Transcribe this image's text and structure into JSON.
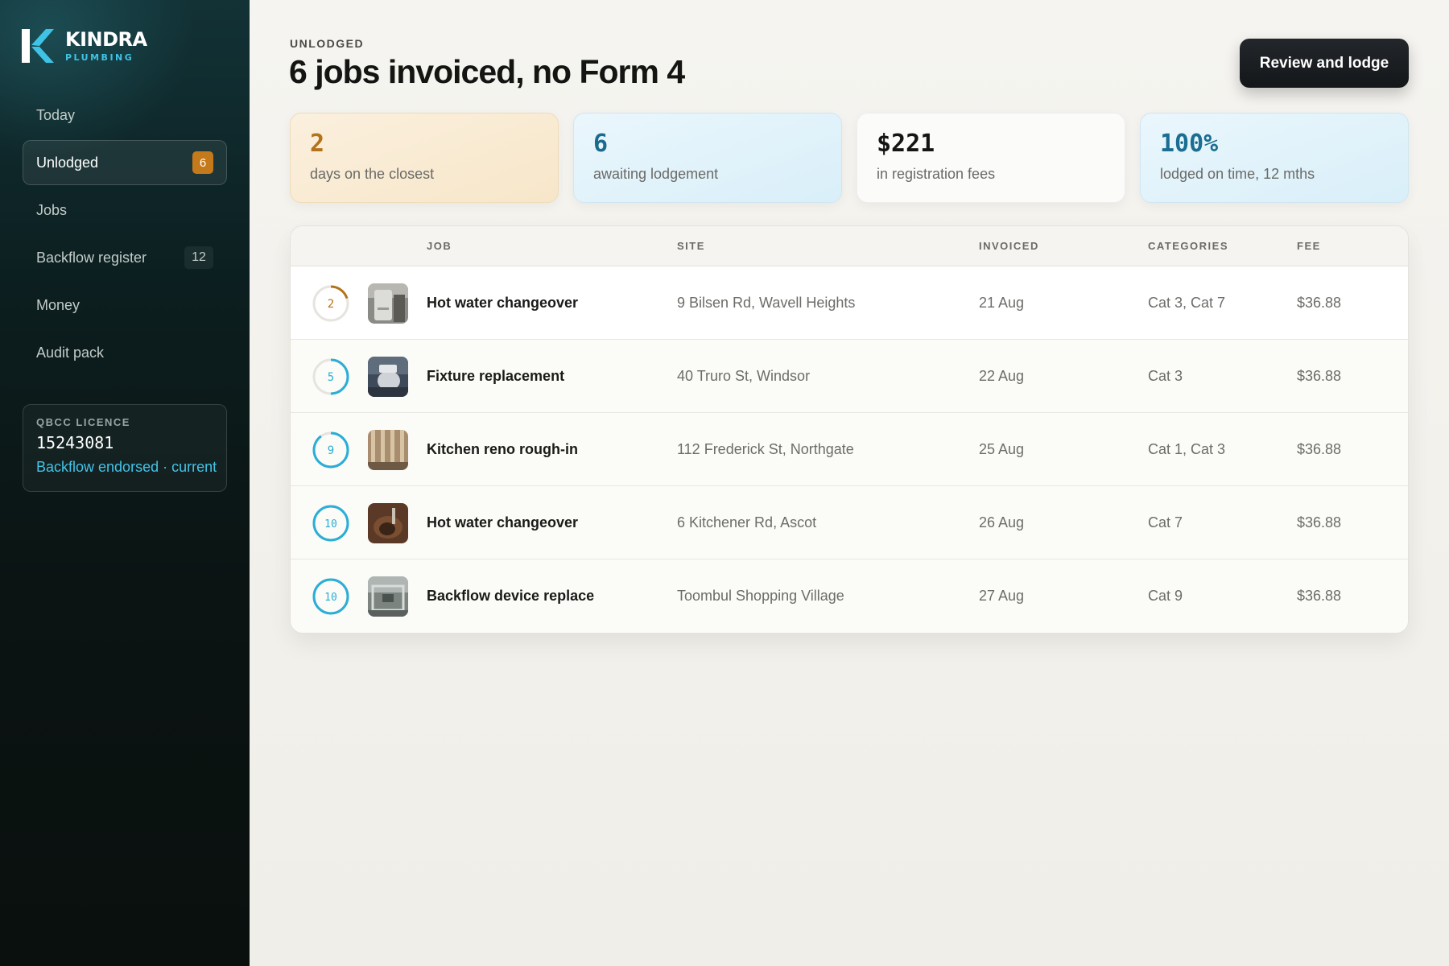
{
  "brand": {
    "name": "KINDRA",
    "sub": "PLUMBING"
  },
  "nav": [
    {
      "label": "Today",
      "badge": null
    },
    {
      "label": "Unlodged",
      "badge": "6"
    },
    {
      "label": "Jobs",
      "badge": null
    },
    {
      "label": "Backflow register",
      "badge": "12"
    },
    {
      "label": "Money",
      "badge": null
    },
    {
      "label": "Audit pack",
      "badge": null
    }
  ],
  "licence": {
    "label": "QBCC LICENCE",
    "number": "15243081",
    "status": "Backflow endorsed · current"
  },
  "header": {
    "eyebrow": "UNLODGED",
    "title": "6 jobs invoiced, no Form 4",
    "cta": "Review and lodge"
  },
  "stats": [
    {
      "value": "2",
      "label": "days on the closest"
    },
    {
      "value": "6",
      "label": "awaiting lodgement"
    },
    {
      "value": "$221",
      "label": "in registration fees"
    },
    {
      "value": "100%",
      "label": "lodged on time, 12 mths"
    }
  ],
  "table": {
    "columns": [
      "JOB",
      "SITE",
      "INVOICED",
      "CATEGORIES",
      "FEE"
    ],
    "rows": [
      {
        "days": "2",
        "days_fraction": 0.2,
        "ring_color": "#b4721a",
        "thumb_icon": "hot-water-thumbnail",
        "job": "Hot water changeover",
        "site": "9 Bilsen Rd, Wavell Heights",
        "invoiced": "21 Aug",
        "categories": "Cat 3, Cat 7",
        "fee": "$36.88"
      },
      {
        "days": "5",
        "days_fraction": 0.5,
        "ring_color": "#2aaed6",
        "thumb_icon": "fixture-thumbnail",
        "job": "Fixture replacement",
        "site": "40 Truro St, Windsor",
        "invoiced": "22 Aug",
        "categories": "Cat 3",
        "fee": "$36.88"
      },
      {
        "days": "9",
        "days_fraction": 0.9,
        "ring_color": "#2aaed6",
        "thumb_icon": "kitchen-thumbnail",
        "job": "Kitchen reno rough-in",
        "site": "112 Frederick St, Northgate",
        "invoiced": "25 Aug",
        "categories": "Cat 1, Cat 3",
        "fee": "$36.88"
      },
      {
        "days": "10",
        "days_fraction": 1.0,
        "ring_color": "#2aaed6",
        "thumb_icon": "excavation-thumbnail",
        "job": "Hot water changeover",
        "site": "6 Kitchener Rd, Ascot",
        "invoiced": "26 Aug",
        "categories": "Cat 7",
        "fee": "$36.88"
      },
      {
        "days": "10",
        "days_fraction": 1.0,
        "ring_color": "#2aaed6",
        "thumb_icon": "backflow-thumbnail",
        "job": "Backflow device replace",
        "site": "Toombul Shopping Village",
        "invoiced": "27 Aug",
        "categories": "Cat 9",
        "fee": "$36.88"
      }
    ]
  }
}
